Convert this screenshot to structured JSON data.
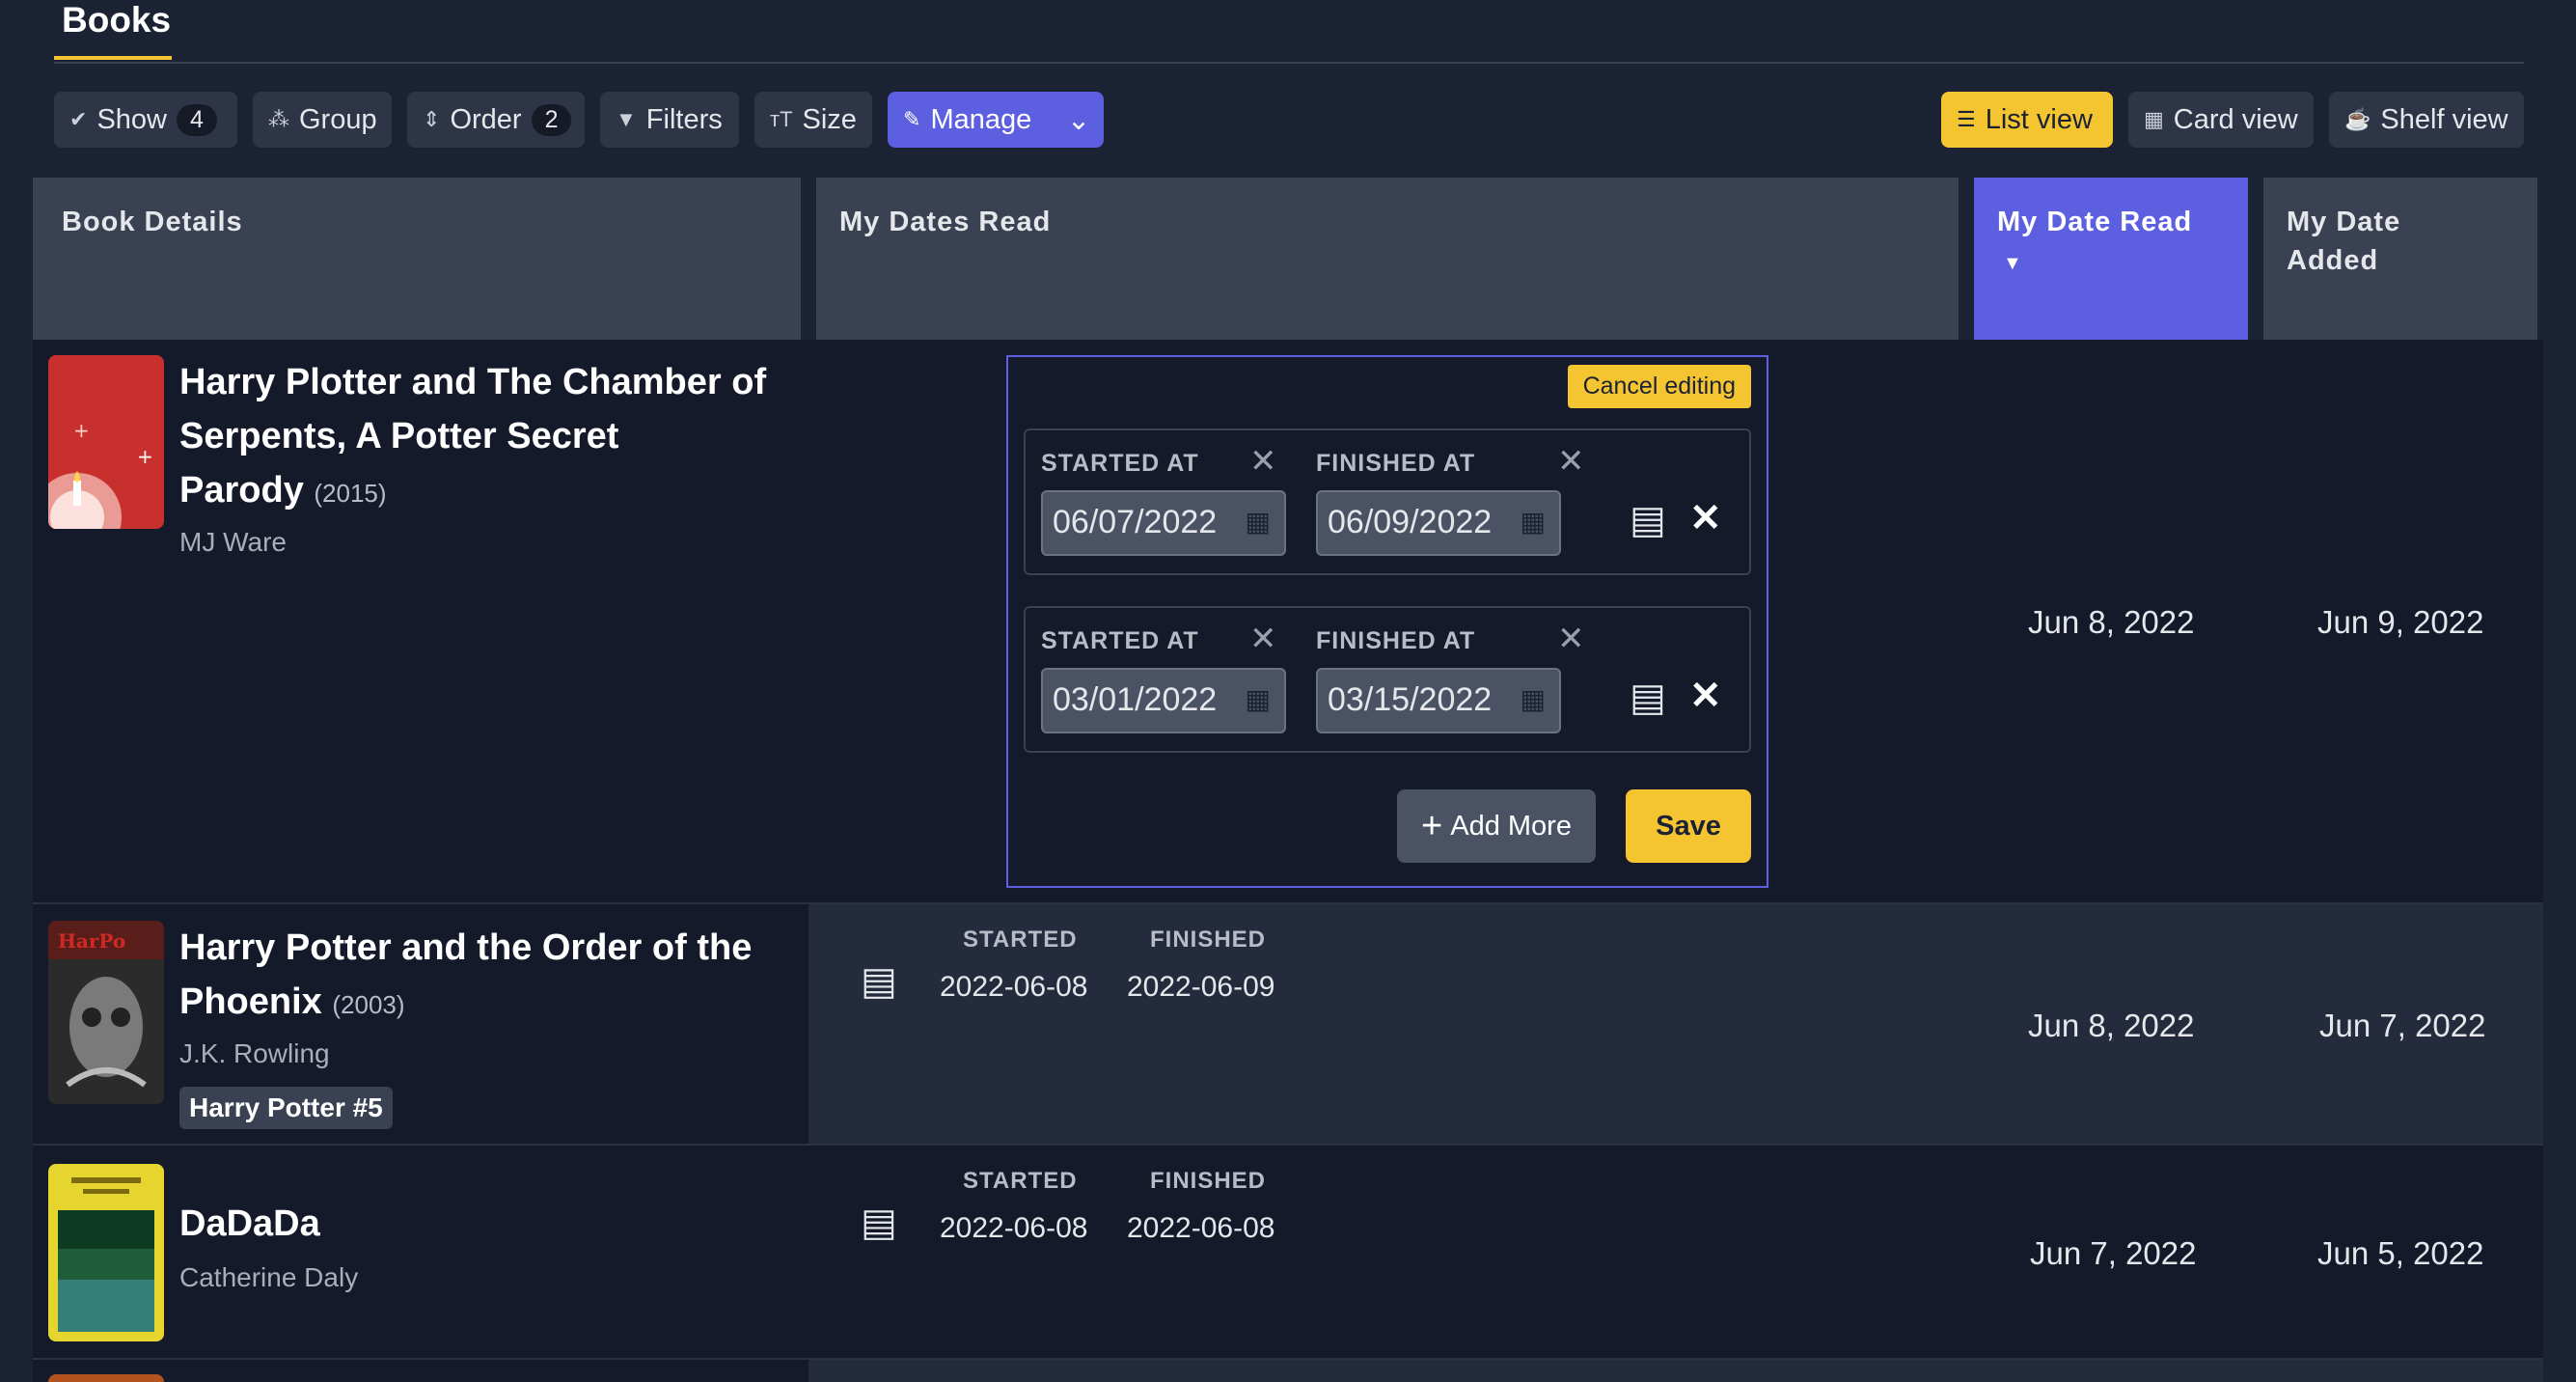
{
  "tabs": {
    "active": "Books"
  },
  "toolbar": {
    "show_label": "Show",
    "show_count": "4",
    "group_label": "Group",
    "order_label": "Order",
    "order_count": "2",
    "filters_label": "Filters",
    "size_label": "Size",
    "manage_label": "Manage",
    "list_view_label": "List view",
    "card_view_label": "Card view",
    "shelf_view_label": "Shelf view"
  },
  "columns": {
    "book_details": "Book Details",
    "my_dates_read": "My Dates Read",
    "my_date_read": "My Date Read",
    "my_date_added_1": "My Date",
    "my_date_added_2": "Added"
  },
  "editor": {
    "cancel_label": "Cancel editing",
    "started_label": "STARTED AT",
    "finished_label": "FINISHED AT",
    "entries": [
      {
        "started": "06/07/2022",
        "finished": "06/09/2022"
      },
      {
        "started": "03/01/2022",
        "finished": "03/15/2022"
      }
    ],
    "add_more_label": "Add More",
    "save_label": "Save"
  },
  "books": [
    {
      "title_1": "Harry Plotter and The Chamber of",
      "title_2": "Serpents, A Potter Secret",
      "title_3": "Parody",
      "year": "(2015)",
      "author": "MJ Ware",
      "date_read": "Jun 8, 2022",
      "date_added": "Jun 9, 2022",
      "cover_color": "#c8302e"
    },
    {
      "title_1": "Harry Potter and the Order of the",
      "title_2": "Phoenix",
      "year": "(2003)",
      "author": "J.K. Rowling",
      "series": "Harry Potter #5",
      "started_label": "STARTED",
      "finished_label": "FINISHED",
      "started": "2022-06-08",
      "finished": "2022-06-09",
      "date_read": "Jun 8, 2022",
      "date_added": "Jun 7, 2022"
    },
    {
      "title_1": "DaDaDa",
      "author": "Catherine Daly",
      "started_label": "STARTED",
      "finished_label": "FINISHED",
      "started": "2022-06-08",
      "finished": "2022-06-08",
      "date_read": "Jun 7, 2022",
      "date_added": "Jun 5, 2022",
      "cover_color": "#e7d52f"
    }
  ],
  "colors": {
    "accent": "#5b5fe0",
    "highlight": "#f5c431",
    "background": "#1b2233"
  }
}
